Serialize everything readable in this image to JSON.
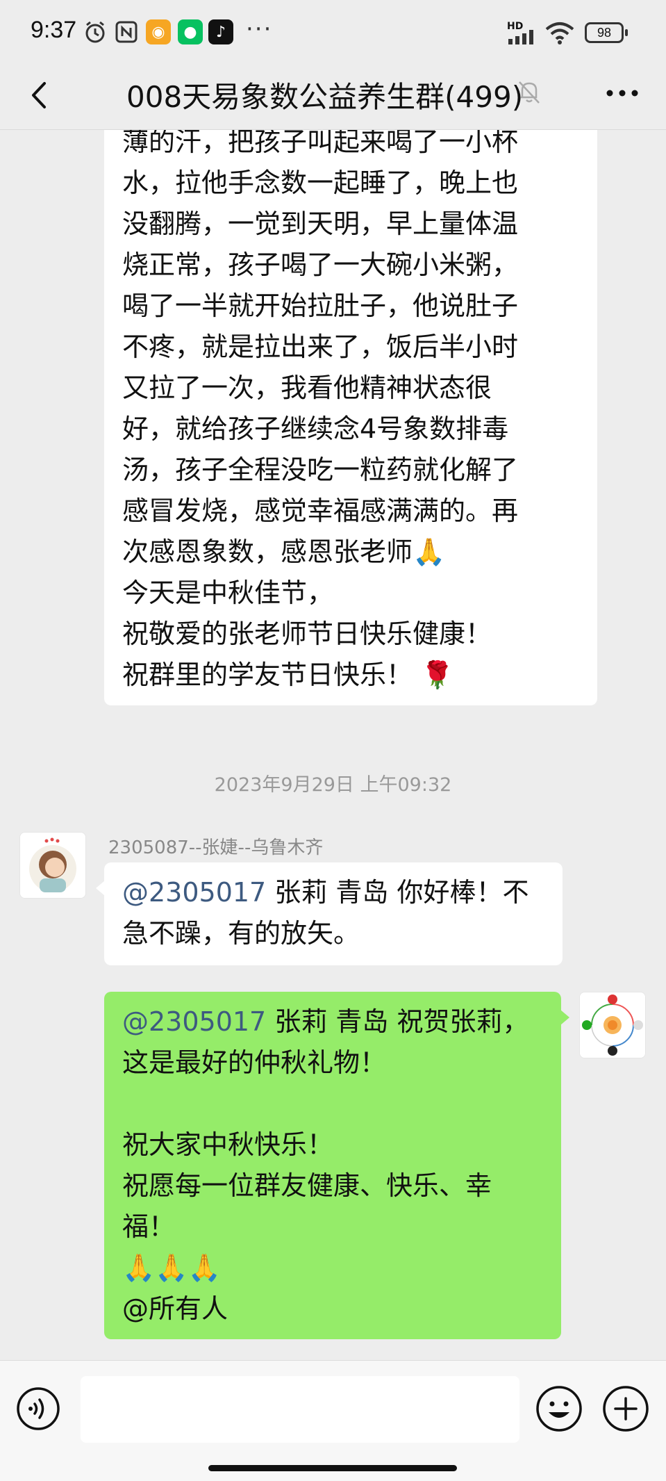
{
  "status_bar": {
    "time": "9:37",
    "network": "HD",
    "battery": "98",
    "overflow": "···"
  },
  "header": {
    "title": "008天易象数公益养生群(499)"
  },
  "messages": {
    "first": {
      "lines": [
        "薄的汗，把孩子叫起来喝了一小杯",
        "水，拉他手念数一起睡了，晚上也",
        "没翻腾，一觉到天明，早上量体温",
        "烧正常，孩子喝了一大碗小米粥，",
        "喝了一半就开始拉肚子，他说肚子",
        "不疼，就是拉出来了，饭后半小时",
        "又拉了一次，我看他精神状态很",
        "好，就给孩子继续念4号象数排毒",
        "汤，孩子全程没吃一粒药就化解了",
        "感冒发烧，感觉幸福感满满的。再",
        "次感恩象数，感恩张老师🙏",
        "今天是中秋佳节，",
        "祝敬爱的张老师节日快乐健康！",
        "祝群里的学友节日快乐！ 🌹"
      ]
    },
    "timestamp": "2023年9月29日 上午09:32",
    "second": {
      "sender": "2305087--张婕--乌鲁木齐",
      "mention": "@2305017",
      "line1_rest": " 张莉 青岛  你好棒！不",
      "line2": "急不躁，有的放矢。"
    },
    "third": {
      "mention": "@2305017",
      "line1_rest": " 张莉 青岛  祝贺张莉，",
      "line2": "这是最好的仲秋礼物！",
      "line3": "",
      "line4": "祝大家中秋快乐！",
      "line5": "祝愿每一位群友健康、快乐、幸",
      "line6": "福！",
      "line7": "🙏🙏🙏",
      "line8": "@所有人"
    }
  },
  "colors": {
    "background": "#ededed",
    "self_bubble": "#95ec69",
    "other_bubble": "#ffffff",
    "mention": "#3d5a80"
  },
  "icons": [
    "back-icon",
    "mute-bell-icon",
    "more-icon",
    "alarm-icon",
    "nfc-icon",
    "app-icon",
    "wechat-icon",
    "tiktok-icon",
    "signal-icon",
    "wifi-icon",
    "voice-icon",
    "emoji-icon",
    "plus-icon"
  ]
}
